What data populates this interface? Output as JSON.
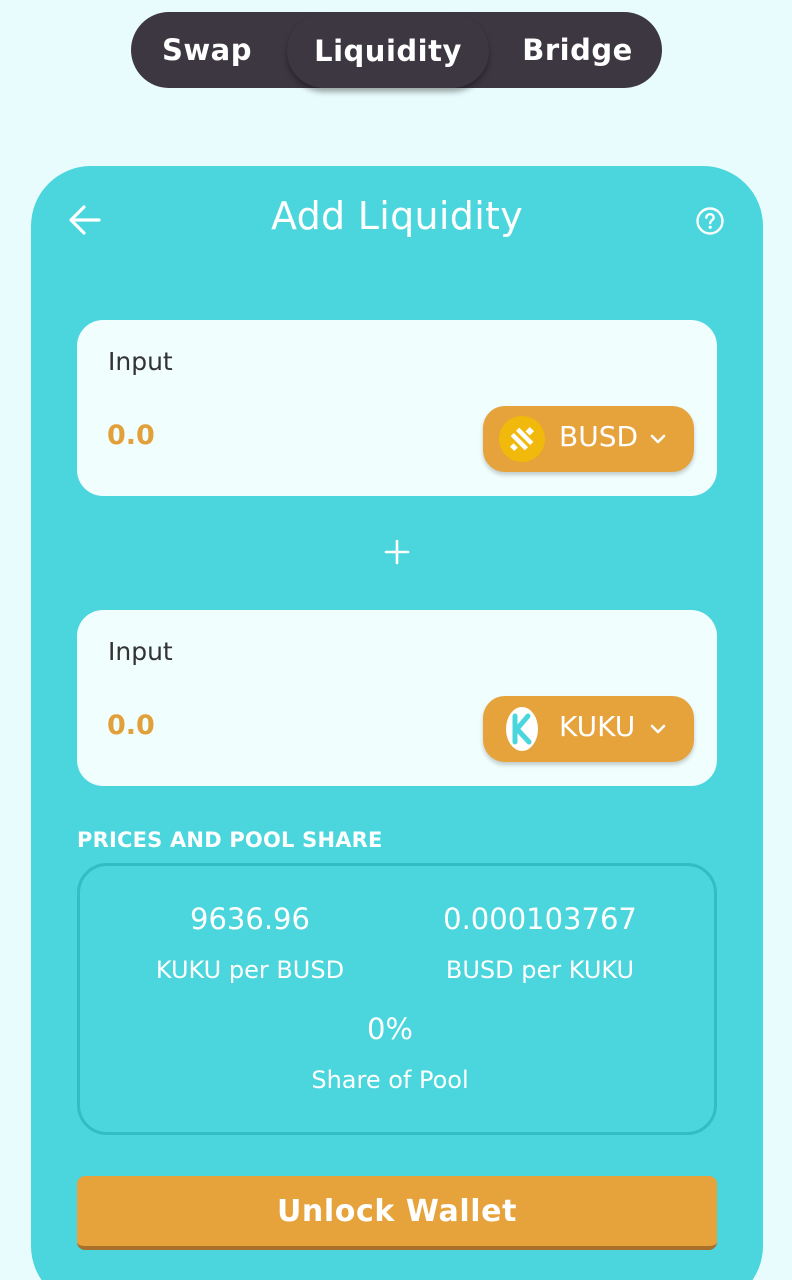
{
  "nav": {
    "tabs": [
      {
        "label": "Swap"
      },
      {
        "label": "Liquidity",
        "active": true
      },
      {
        "label": "Bridge"
      }
    ]
  },
  "header": {
    "title": "Add Liquidity",
    "back_icon": "arrow-left-icon",
    "help_icon": "question-circle-icon"
  },
  "inputs": [
    {
      "label": "Input",
      "value": "0.0",
      "token": "BUSD",
      "token_icon": "busd-logo-icon"
    },
    {
      "label": "Input",
      "value": "0.0",
      "token": "KUKU",
      "token_icon": "kuku-logo-icon"
    }
  ],
  "plus_icon": "plus-icon",
  "prices": {
    "section_label": "PRICES AND POOL SHARE",
    "kuku_per_busd": {
      "value": "9636.96",
      "label": "KUKU per BUSD"
    },
    "busd_per_kuku": {
      "value": "0.000103767",
      "label": "BUSD per KUKU"
    },
    "share": {
      "value": "0%",
      "label": "Share of Pool"
    }
  },
  "action": {
    "label": "Unlock Wallet"
  },
  "colors": {
    "background": "#e9fcfd",
    "nav": "#3d3742",
    "card": "#4ad6dc",
    "accent": "#e6a23b",
    "input_value": "#e2a03a"
  }
}
